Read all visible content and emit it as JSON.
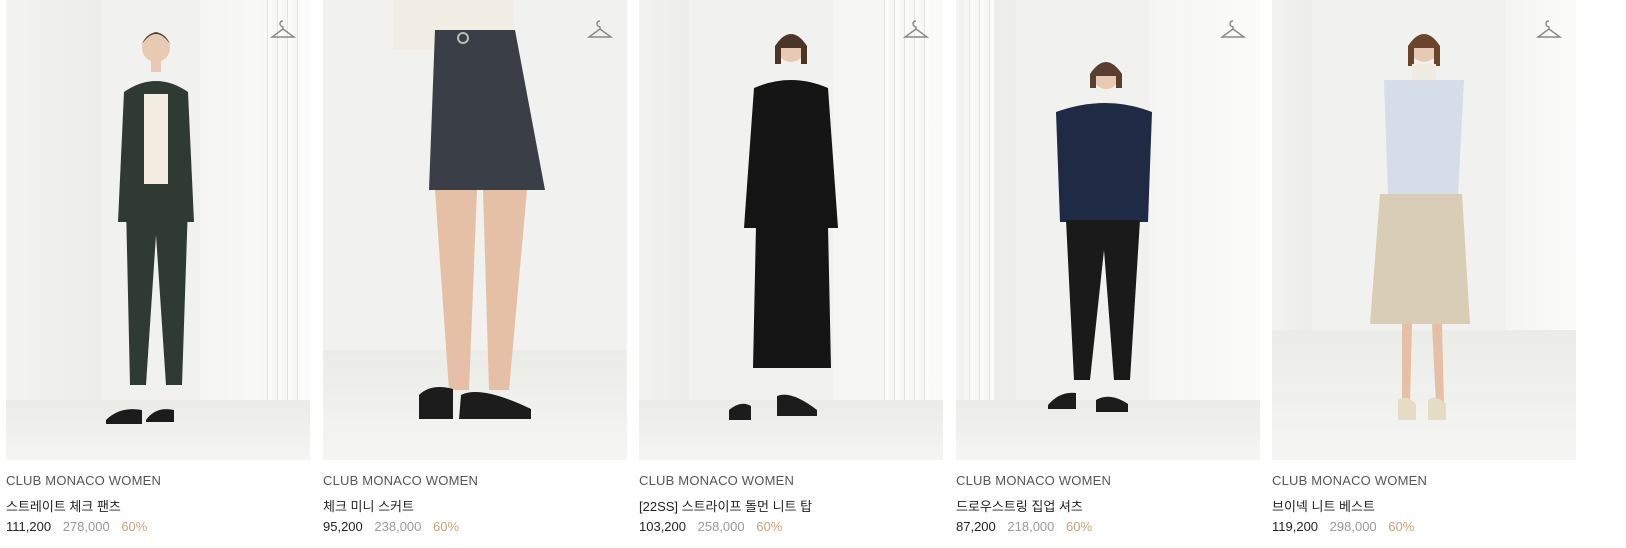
{
  "products": [
    {
      "brand": "CLUB MONACO WOMEN",
      "name": "스트레이트 체크 팬츠",
      "sale_price": "111,200",
      "original_price": "278,000",
      "discount": "60%",
      "icon": "hanger-icon",
      "colors": {
        "top": "#2f3a33",
        "bottom": "#2f3a33",
        "inner": "#f3ece1",
        "shoes": "#1c1c1c"
      }
    },
    {
      "brand": "CLUB MONACO WOMEN",
      "name": "체크 미니 스커트",
      "sale_price": "95,200",
      "original_price": "238,000",
      "discount": "60%",
      "icon": "hanger-icon",
      "colors": {
        "top": "#f2ede4",
        "bottom": "#3a3e47",
        "inner": "#f2ede4",
        "shoes": "#1c1c1c"
      }
    },
    {
      "brand": "CLUB MONACO WOMEN",
      "name": "[22SS] 스트라이프 돌먼 니트 탑",
      "sale_price": "103,200",
      "original_price": "258,000",
      "discount": "60%",
      "icon": "hanger-icon",
      "colors": {
        "top": "#151515",
        "bottom": "#151515",
        "inner": "#151515",
        "shoes": "#1c1c1c"
      }
    },
    {
      "brand": "CLUB MONACO WOMEN",
      "name": "드로우스트링 집업 셔츠",
      "sale_price": "87,200",
      "original_price": "218,000",
      "discount": "60%",
      "icon": "hanger-icon",
      "colors": {
        "top": "#1f2a44",
        "bottom": "#1a1a1a",
        "inner": "#1f2a44",
        "shoes": "#1c1c1c"
      }
    },
    {
      "brand": "CLUB MONACO WOMEN",
      "name": "브이넥 니트 베스트",
      "sale_price": "119,200",
      "original_price": "298,000",
      "discount": "60%",
      "icon": "hanger-icon",
      "colors": {
        "top": "#d4dde8",
        "bottom": "#d9cdb6",
        "inner": "#f1ece2",
        "shoes": "#e6dcc6"
      }
    }
  ]
}
